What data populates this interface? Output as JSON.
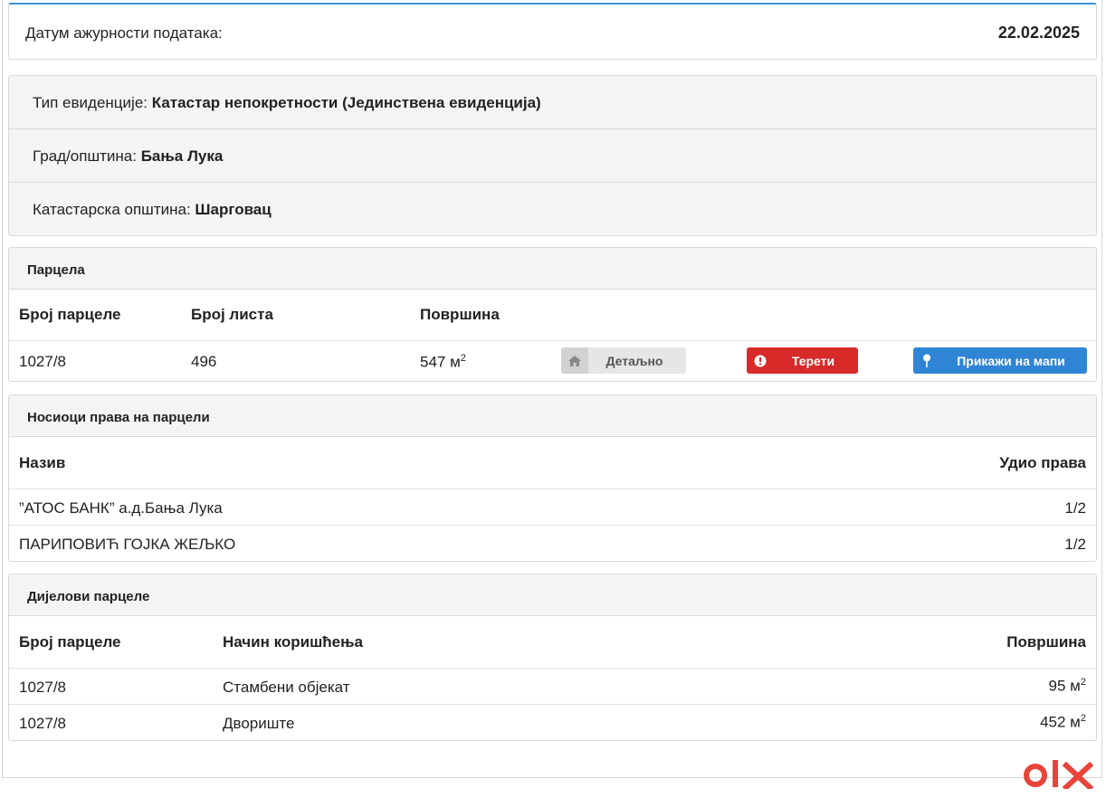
{
  "update": {
    "label": "Датум ажурности података:",
    "value": "22.02.2025"
  },
  "info": {
    "record_type_label": "Тип евиденције:",
    "record_type_value": "Катастар непокретности (Јединствена евиденција)",
    "city_label": "Град/општина:",
    "city_value": "Бања Лука",
    "cadastral_label": "Катастарска општина:",
    "cadastral_value": "Шарговац"
  },
  "parcel": {
    "title": "Парцела",
    "headers": {
      "number": "Број парцеле",
      "sheet": "Број листа",
      "area": "Површина"
    },
    "row": {
      "number": "1027/8",
      "sheet": "496",
      "area": "547 м",
      "area_unit_sup": "2"
    },
    "buttons": {
      "detail": "Детаљно",
      "burdens": "Терети",
      "map": "Прикажи на мапи"
    }
  },
  "owners": {
    "title": "Носиоци права на парцели",
    "headers": {
      "name": "Назив",
      "share": "Удио права"
    },
    "rows": [
      {
        "name": "”АТОС БАНК” а.д.Бања Лука",
        "share": "1/2"
      },
      {
        "name": "ПАРИПОВИЋ ГОЈКА ЖЕЉКО",
        "share": "1/2"
      }
    ]
  },
  "parts": {
    "title": "Дијелови парцеле",
    "headers": {
      "number": "Број парцеле",
      "usage": "Начин коришћења",
      "area": "Површина"
    },
    "rows": [
      {
        "number": "1027/8",
        "usage": "Стамбени објекат",
        "area": "95 м",
        "sup": "2"
      },
      {
        "number": "1027/8",
        "usage": "Двориште",
        "area": "452 м",
        "sup": "2"
      }
    ]
  },
  "colors": {
    "accent": "#3b8fd6",
    "danger": "#d92a2a",
    "primary": "#2f84d4",
    "olx_red": "#e8443a"
  },
  "icons": {
    "detail": "home-icon",
    "burdens": "exclamation-circle-icon",
    "map": "map-pin-icon"
  }
}
